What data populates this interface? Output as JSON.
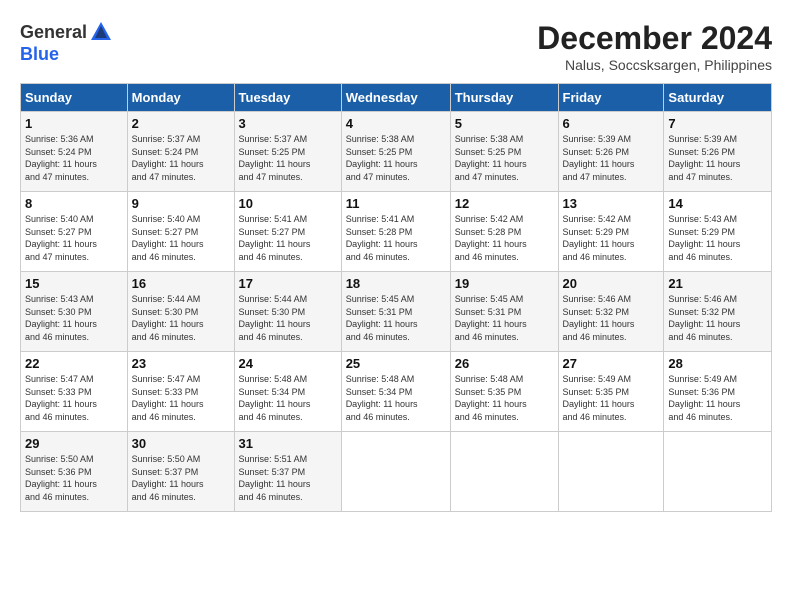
{
  "logo": {
    "general": "General",
    "blue": "Blue"
  },
  "title": "December 2024",
  "subtitle": "Nalus, Soccsksargen, Philippines",
  "weekdays": [
    "Sunday",
    "Monday",
    "Tuesday",
    "Wednesday",
    "Thursday",
    "Friday",
    "Saturday"
  ],
  "weeks": [
    [
      {
        "day": "1",
        "sunrise": "5:36 AM",
        "sunset": "5:24 PM",
        "daylight": "11 hours and 47 minutes."
      },
      {
        "day": "2",
        "sunrise": "5:37 AM",
        "sunset": "5:24 PM",
        "daylight": "11 hours and 47 minutes."
      },
      {
        "day": "3",
        "sunrise": "5:37 AM",
        "sunset": "5:25 PM",
        "daylight": "11 hours and 47 minutes."
      },
      {
        "day": "4",
        "sunrise": "5:38 AM",
        "sunset": "5:25 PM",
        "daylight": "11 hours and 47 minutes."
      },
      {
        "day": "5",
        "sunrise": "5:38 AM",
        "sunset": "5:25 PM",
        "daylight": "11 hours and 47 minutes."
      },
      {
        "day": "6",
        "sunrise": "5:39 AM",
        "sunset": "5:26 PM",
        "daylight": "11 hours and 47 minutes."
      },
      {
        "day": "7",
        "sunrise": "5:39 AM",
        "sunset": "5:26 PM",
        "daylight": "11 hours and 47 minutes."
      }
    ],
    [
      {
        "day": "8",
        "sunrise": "5:40 AM",
        "sunset": "5:27 PM",
        "daylight": "11 hours and 47 minutes."
      },
      {
        "day": "9",
        "sunrise": "5:40 AM",
        "sunset": "5:27 PM",
        "daylight": "11 hours and 46 minutes."
      },
      {
        "day": "10",
        "sunrise": "5:41 AM",
        "sunset": "5:27 PM",
        "daylight": "11 hours and 46 minutes."
      },
      {
        "day": "11",
        "sunrise": "5:41 AM",
        "sunset": "5:28 PM",
        "daylight": "11 hours and 46 minutes."
      },
      {
        "day": "12",
        "sunrise": "5:42 AM",
        "sunset": "5:28 PM",
        "daylight": "11 hours and 46 minutes."
      },
      {
        "day": "13",
        "sunrise": "5:42 AM",
        "sunset": "5:29 PM",
        "daylight": "11 hours and 46 minutes."
      },
      {
        "day": "14",
        "sunrise": "5:43 AM",
        "sunset": "5:29 PM",
        "daylight": "11 hours and 46 minutes."
      }
    ],
    [
      {
        "day": "15",
        "sunrise": "5:43 AM",
        "sunset": "5:30 PM",
        "daylight": "11 hours and 46 minutes."
      },
      {
        "day": "16",
        "sunrise": "5:44 AM",
        "sunset": "5:30 PM",
        "daylight": "11 hours and 46 minutes."
      },
      {
        "day": "17",
        "sunrise": "5:44 AM",
        "sunset": "5:30 PM",
        "daylight": "11 hours and 46 minutes."
      },
      {
        "day": "18",
        "sunrise": "5:45 AM",
        "sunset": "5:31 PM",
        "daylight": "11 hours and 46 minutes."
      },
      {
        "day": "19",
        "sunrise": "5:45 AM",
        "sunset": "5:31 PM",
        "daylight": "11 hours and 46 minutes."
      },
      {
        "day": "20",
        "sunrise": "5:46 AM",
        "sunset": "5:32 PM",
        "daylight": "11 hours and 46 minutes."
      },
      {
        "day": "21",
        "sunrise": "5:46 AM",
        "sunset": "5:32 PM",
        "daylight": "11 hours and 46 minutes."
      }
    ],
    [
      {
        "day": "22",
        "sunrise": "5:47 AM",
        "sunset": "5:33 PM",
        "daylight": "11 hours and 46 minutes."
      },
      {
        "day": "23",
        "sunrise": "5:47 AM",
        "sunset": "5:33 PM",
        "daylight": "11 hours and 46 minutes."
      },
      {
        "day": "24",
        "sunrise": "5:48 AM",
        "sunset": "5:34 PM",
        "daylight": "11 hours and 46 minutes."
      },
      {
        "day": "25",
        "sunrise": "5:48 AM",
        "sunset": "5:34 PM",
        "daylight": "11 hours and 46 minutes."
      },
      {
        "day": "26",
        "sunrise": "5:48 AM",
        "sunset": "5:35 PM",
        "daylight": "11 hours and 46 minutes."
      },
      {
        "day": "27",
        "sunrise": "5:49 AM",
        "sunset": "5:35 PM",
        "daylight": "11 hours and 46 minutes."
      },
      {
        "day": "28",
        "sunrise": "5:49 AM",
        "sunset": "5:36 PM",
        "daylight": "11 hours and 46 minutes."
      }
    ],
    [
      {
        "day": "29",
        "sunrise": "5:50 AM",
        "sunset": "5:36 PM",
        "daylight": "11 hours and 46 minutes."
      },
      {
        "day": "30",
        "sunrise": "5:50 AM",
        "sunset": "5:37 PM",
        "daylight": "11 hours and 46 minutes."
      },
      {
        "day": "31",
        "sunrise": "5:51 AM",
        "sunset": "5:37 PM",
        "daylight": "11 hours and 46 minutes."
      },
      null,
      null,
      null,
      null
    ]
  ]
}
